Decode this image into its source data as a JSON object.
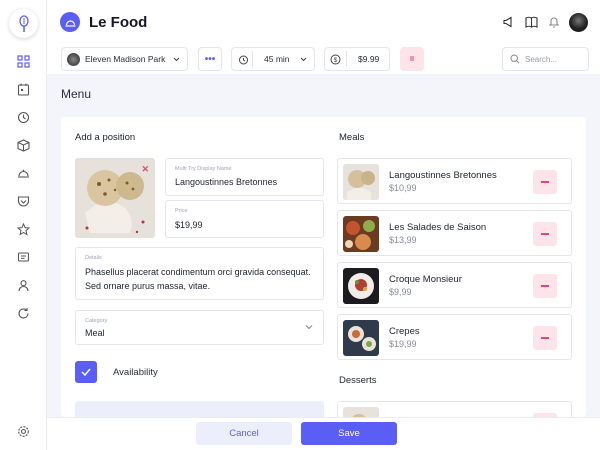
{
  "app": {
    "title": "Le Food"
  },
  "colors": {
    "accent": "#5b5ef4",
    "danger": "#e0486e",
    "danger_bg": "#fde3ea"
  },
  "sidebar": {
    "logo_icon": "chef-whisk-icon",
    "items": [
      {
        "icon": "grid-icon"
      },
      {
        "icon": "calendar-icon"
      },
      {
        "icon": "clock-icon"
      },
      {
        "icon": "box-icon"
      },
      {
        "icon": "cloche-icon"
      },
      {
        "icon": "pocket-icon"
      },
      {
        "icon": "star-icon"
      },
      {
        "icon": "message-icon"
      },
      {
        "icon": "user-icon"
      },
      {
        "icon": "refresh-icon"
      }
    ],
    "settings_icon": "gear-icon"
  },
  "header": {
    "icons": [
      "megaphone-icon",
      "book-icon",
      "bell-icon"
    ]
  },
  "toolbar": {
    "restaurant": "Eleven Madison Park",
    "more": "•••",
    "time": "45 min",
    "price": "$9.99",
    "pause": "II",
    "search_placeholder": "Search..."
  },
  "page": {
    "title": "Menu"
  },
  "form": {
    "title": "Add a position",
    "name_label": "Multi Try Display Name",
    "name_value": "Langoustinnes Bretonnes",
    "price_label": "Price",
    "price_value": "$19,99",
    "details_label": "Details",
    "details_value": "Phasellus placerat condimentum orci gravida consequat. Sed ornare purus massa, vitae.",
    "category_label": "Category",
    "category_value": "Meal",
    "availability_label": "Availability",
    "availability_checked": true
  },
  "meals": {
    "title": "Meals",
    "items": [
      {
        "name": "Langoustinnes Bretonnes",
        "price": "$10,99"
      },
      {
        "name": "Les Salades de Saison",
        "price": "$13,99"
      },
      {
        "name": "Croque Monsieur",
        "price": "$9,99"
      },
      {
        "name": "Crepes",
        "price": "$19,99"
      }
    ]
  },
  "desserts": {
    "title": "Desserts"
  },
  "footer": {
    "cancel_label": "Cancel",
    "save_label": "Save"
  }
}
